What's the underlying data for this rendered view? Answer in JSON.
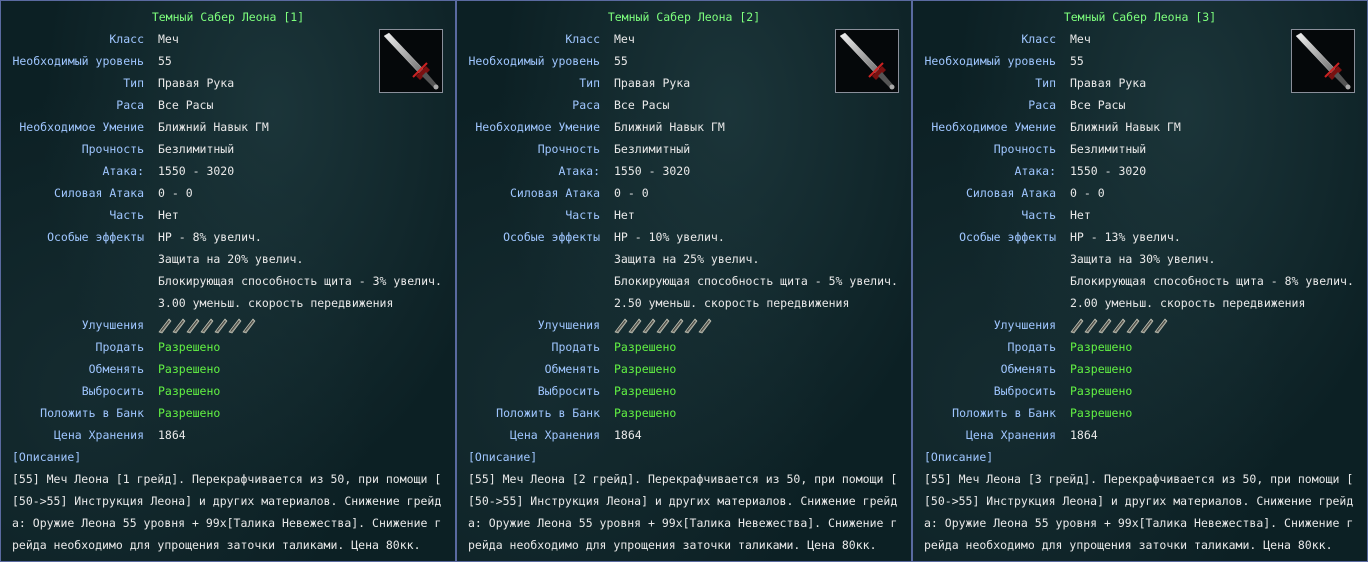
{
  "labels": {
    "class": "Класс",
    "level": "Необходимый уровень",
    "type": "Тип",
    "race": "Раса",
    "skill": "Необходимое Умение",
    "durability": "Прочность",
    "attack": "Атака:",
    "power_attack": "Силовая Атака",
    "part": "Часть",
    "effects": "Особые эффекты",
    "upgrades": "Улучшения",
    "sell": "Продать",
    "trade": "Обменять",
    "drop": "Выбросить",
    "bank": "Положить в Банк",
    "storage_price": "Цена Хранения",
    "description": "[Описание]"
  },
  "icons": {
    "item": "dark-saber-icon",
    "upgrade": "upgrade-gem-icon"
  },
  "upgrade_slots": 7,
  "panels": [
    {
      "title": "Темный Сабер Леона [1]",
      "class": "Меч",
      "level": "55",
      "type": "Правая Рука",
      "race": "Все Расы",
      "skill": "Ближний Навык ГМ",
      "durability": "Безлимитный",
      "attack": "1550 - 3020",
      "power_attack": "0 - 0",
      "part": "Нет",
      "effects": [
        "HP - 8% увелич.",
        "Защита на 20% увелич.",
        "Блокирующая способность щита - 3% увелич.",
        "3.00 уменьш. скорость передвижения"
      ],
      "sell": "Разрешено",
      "trade": "Разрешено",
      "drop": "Разрешено",
      "bank": "Разрешено",
      "storage_price": "1864",
      "description_lines": [
        "[55] Меч Леона [1 грейд]. Перекрафчивается из 50, при помощи [",
        "[50->55] Инструкция Леона] и других материалов. Снижение грейд",
        "а: Оружие Леона 55 уровня + 99х[Талика Невежества]. Снижение г",
        "рейда необходимо для упрощения заточки таликами. Цена 80кк."
      ]
    },
    {
      "title": "Темный Сабер Леона [2]",
      "class": "Меч",
      "level": "55",
      "type": "Правая Рука",
      "race": "Все Расы",
      "skill": "Ближний Навык ГМ",
      "durability": "Безлимитный",
      "attack": "1550 - 3020",
      "power_attack": "0 - 0",
      "part": "Нет",
      "effects": [
        "HP - 10% увелич.",
        "Защита на 25% увелич.",
        "Блокирующая способность щита - 5% увелич.",
        "2.50 уменьш. скорость передвижения"
      ],
      "sell": "Разрешено",
      "trade": "Разрешено",
      "drop": "Разрешено",
      "bank": "Разрешено",
      "storage_price": "1864",
      "description_lines": [
        "[55] Меч Леона [2 грейд]. Перекрафчивается из 50, при помощи [",
        "[50->55] Инструкция Леона] и других материалов. Снижение грейд",
        "а: Оружие Леона 55 уровня + 99х[Талика Невежества]. Снижение г",
        "рейда необходимо для упрощения заточки таликами. Цена 80кк."
      ]
    },
    {
      "title": "Темный Сабер Леона [3]",
      "class": "Меч",
      "level": "55",
      "type": "Правая Рука",
      "race": "Все Расы",
      "skill": "Ближний Навык ГМ",
      "durability": "Безлимитный",
      "attack": "1550 - 3020",
      "power_attack": "0 - 0",
      "part": "Нет",
      "effects": [
        "HP - 13% увелич.",
        "Защита на 30% увелич.",
        "Блокирующая способность щита - 8% увелич.",
        "2.00 уменьш. скорость передвижения"
      ],
      "sell": "Разрешено",
      "trade": "Разрешено",
      "drop": "Разрешено",
      "bank": "Разрешено",
      "storage_price": "1864",
      "description_lines": [
        "[55] Меч Леона [3 грейд]. Перекрафчивается из 50, при помощи [",
        "[50->55] Инструкция Леона] и других материалов. Снижение грейд",
        "а: Оружие Леона 55 уровня + 99х[Талика Невежества]. Снижение г",
        "рейда необходимо для упрощения заточки таликами. Цена 80кк."
      ]
    }
  ]
}
